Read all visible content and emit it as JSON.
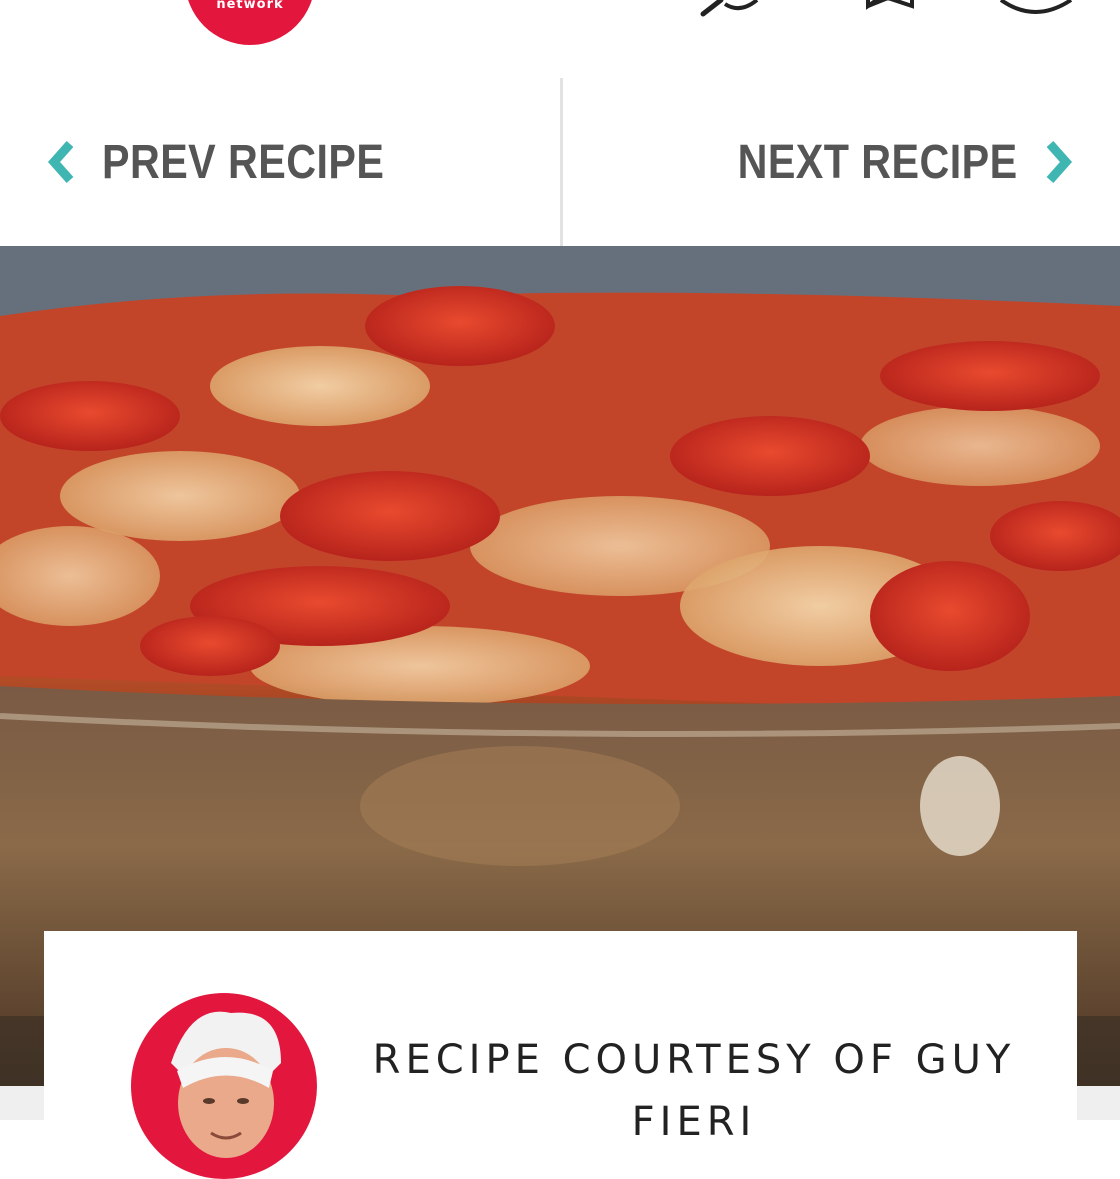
{
  "header": {
    "logo_text": "network",
    "icons": [
      "menu-icon",
      "search-icon",
      "bookmark-icon",
      "profile-icon"
    ],
    "brand_color": "#e3173e"
  },
  "recipe_nav": {
    "prev_label": "PREV RECIPE",
    "next_label": "NEXT RECIPE",
    "chevron_color": "#3fb6b2"
  },
  "hero": {
    "image": "baked lasagna with pepperoni and melted cheese in glass dish"
  },
  "card": {
    "courtesy_line1": "RECIPE COURTESY OF GUY",
    "courtesy_line2": "FIERI"
  }
}
